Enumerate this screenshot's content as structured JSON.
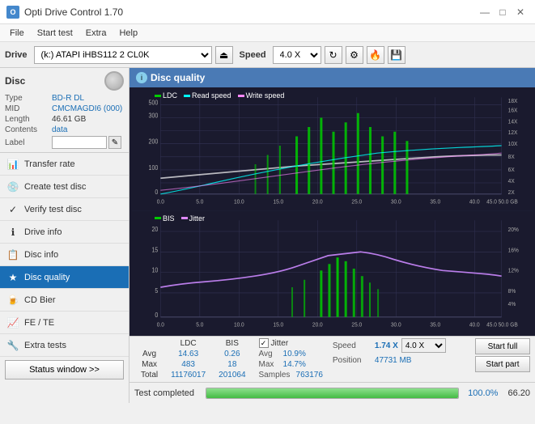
{
  "titlebar": {
    "title": "Opti Drive Control 1.70",
    "icon": "O",
    "minimize": "—",
    "maximize": "□",
    "close": "✕"
  },
  "menubar": {
    "items": [
      "File",
      "Start test",
      "Extra",
      "Help"
    ]
  },
  "drive_toolbar": {
    "drive_label": "Drive",
    "drive_value": "(k:) ATAPI iHBS112  2 CL0K",
    "speed_label": "Speed",
    "speed_value": "4.0 X",
    "eject_icon": "⏏",
    "refresh_icon": "↻"
  },
  "sidebar": {
    "disc_title": "Disc",
    "disc_fields": [
      {
        "label": "Type",
        "value": "BD-R DL",
        "blue": true
      },
      {
        "label": "MID",
        "value": "CMCMAGDI6 (000)",
        "blue": true
      },
      {
        "label": "Length",
        "value": "46.61 GB",
        "blue": false
      },
      {
        "label": "Contents",
        "value": "data",
        "blue": true
      }
    ],
    "label_field": "Label",
    "nav_items": [
      {
        "id": "transfer-rate",
        "label": "Transfer rate",
        "icon": "📊"
      },
      {
        "id": "create-test-disc",
        "label": "Create test disc",
        "icon": "💿"
      },
      {
        "id": "verify-test-disc",
        "label": "Verify test disc",
        "icon": "✓"
      },
      {
        "id": "drive-info",
        "label": "Drive info",
        "icon": "ℹ"
      },
      {
        "id": "disc-info",
        "label": "Disc info",
        "icon": "📋"
      },
      {
        "id": "disc-quality",
        "label": "Disc quality",
        "icon": "★",
        "active": true
      },
      {
        "id": "cd-bier",
        "label": "CD Bier",
        "icon": "🍺"
      },
      {
        "id": "fe-te",
        "label": "FE / TE",
        "icon": "📈"
      },
      {
        "id": "extra-tests",
        "label": "Extra tests",
        "icon": "🔧"
      }
    ],
    "status_btn": "Status window >>"
  },
  "chart_header": {
    "title": "Disc quality",
    "icon": "i"
  },
  "chart1": {
    "legend": [
      {
        "label": "LDC",
        "color": "#00cc00"
      },
      {
        "label": "Read speed",
        "color": "#00ffff"
      },
      {
        "label": "Write speed",
        "color": "#ff88ff"
      }
    ],
    "y_max": 500,
    "y_right_labels": [
      "18X",
      "16X",
      "14X",
      "12X",
      "10X",
      "8X",
      "6X",
      "4X",
      "2X"
    ],
    "x_labels": [
      "0.0",
      "5.0",
      "10.0",
      "15.0",
      "20.0",
      "25.0",
      "30.0",
      "35.0",
      "40.0",
      "45.0",
      "50.0 GB"
    ]
  },
  "chart2": {
    "legend": [
      {
        "label": "BIS",
        "color": "#00cc00"
      },
      {
        "label": "Jitter",
        "color": "#dd88ff"
      }
    ],
    "y_max": 20,
    "y_right_labels": [
      "20%",
      "16%",
      "12%",
      "8%",
      "4%"
    ],
    "x_labels": [
      "0.0",
      "5.0",
      "10.0",
      "15.0",
      "20.0",
      "25.0",
      "30.0",
      "35.0",
      "40.0",
      "45.0",
      "50.0 GB"
    ]
  },
  "stats": {
    "columns": [
      "",
      "LDC",
      "BIS"
    ],
    "rows": [
      {
        "label": "Avg",
        "ldc": "14.63",
        "bis": "0.26"
      },
      {
        "label": "Max",
        "ldc": "483",
        "bis": "18"
      },
      {
        "label": "Total",
        "ldc": "11176017",
        "bis": "201064"
      }
    ],
    "jitter_checked": true,
    "jitter_label": "Jitter",
    "jitter_rows": [
      {
        "label": "Avg",
        "value": "10.9%"
      },
      {
        "label": "Max",
        "value": "14.7%"
      },
      {
        "label": "Samples",
        "value": "763176"
      }
    ],
    "speed_label": "Speed",
    "speed_value": "1.74 X",
    "speed_select": "4.0 X",
    "position_label": "Position",
    "position_value": "47731 MB",
    "btn_start_full": "Start full",
    "btn_start_part": "Start part"
  },
  "progressbar": {
    "label": "Test completed",
    "value": 100.0,
    "display": "100.0%",
    "extra": "66.20"
  }
}
